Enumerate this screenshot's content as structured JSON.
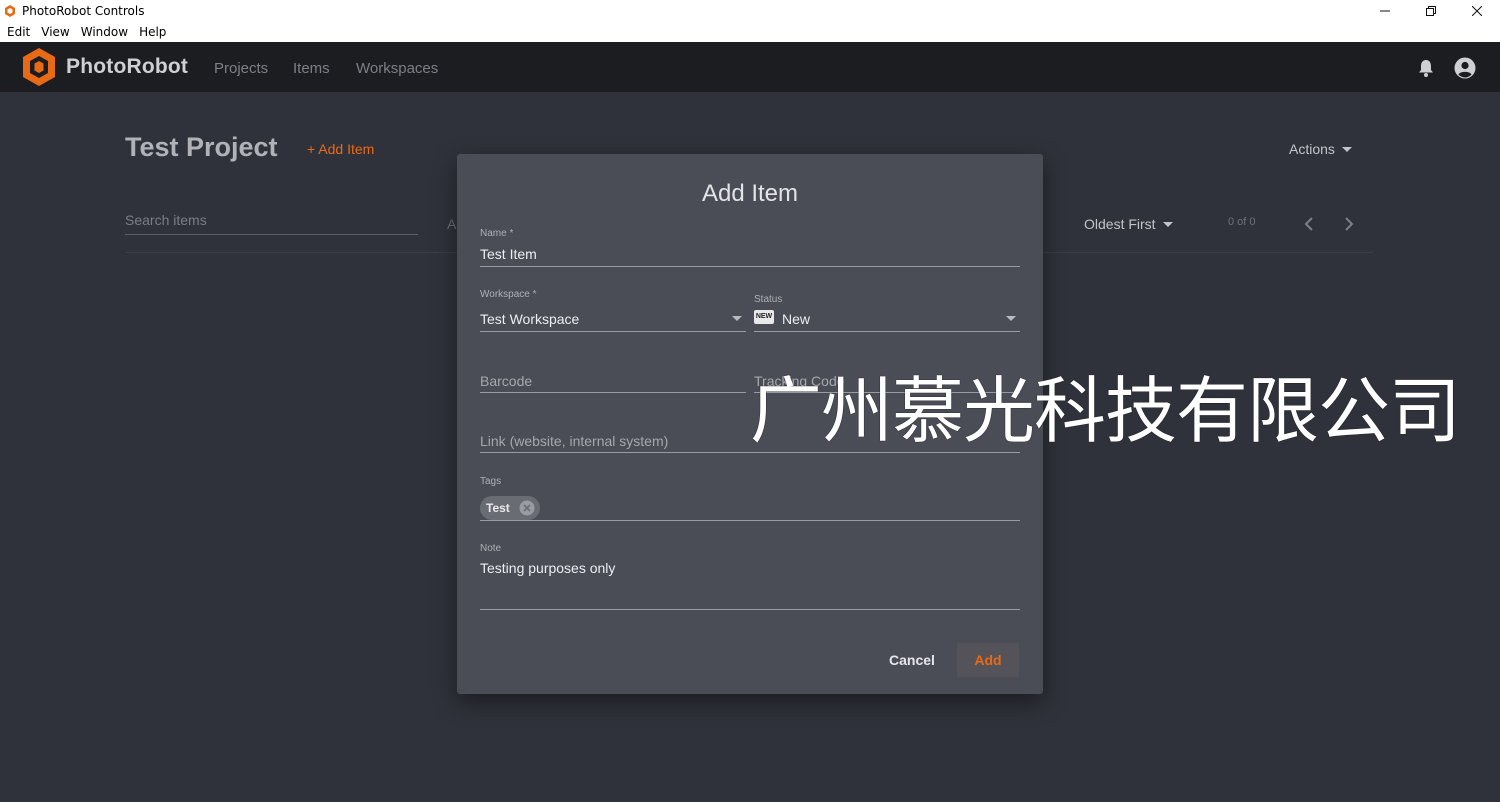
{
  "window": {
    "title": "PhotoRobot Controls"
  },
  "menu": [
    "Edit",
    "View",
    "Window",
    "Help"
  ],
  "appbar": {
    "brand": "PhotoRobot",
    "nav": [
      "Projects",
      "Items",
      "Workspaces"
    ],
    "accent_color": "#e86a16"
  },
  "page": {
    "title": "Test Project",
    "add_item_label": "+ Add Item",
    "actions_label": "Actions",
    "search_placeholder": "Search items",
    "search_rest_fragment": "A",
    "sort_label": "Oldest First",
    "count_label": "0 of 0"
  },
  "dialog": {
    "title": "Add Item",
    "name": {
      "label": "Name *",
      "value": "Test Item"
    },
    "workspace": {
      "label": "Workspace *",
      "value": "Test Workspace"
    },
    "status": {
      "label": "Status",
      "badge": "NEW",
      "value": "New"
    },
    "barcode": {
      "placeholder": "Barcode"
    },
    "tracking": {
      "placeholder": "Tracking Code"
    },
    "link": {
      "placeholder": "Link (website, internal system)"
    },
    "tags": {
      "label": "Tags",
      "items": [
        "Test"
      ]
    },
    "note": {
      "label": "Note",
      "value": "Testing purposes only"
    },
    "cancel_label": "Cancel",
    "add_label": "Add"
  },
  "watermark": "广州慕光科技有限公司"
}
